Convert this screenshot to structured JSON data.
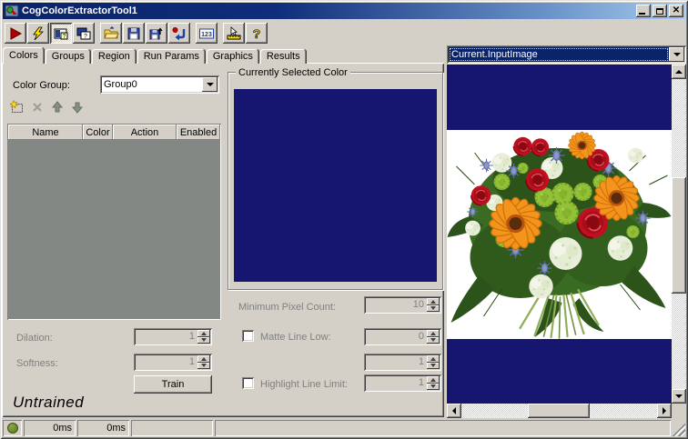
{
  "window": {
    "title": "CogColorExtractorTool1"
  },
  "toolbar": {
    "numeric_label": "123",
    "help_label": "?",
    "tooltip_q": "?"
  },
  "tabs": [
    "Colors",
    "Groups",
    "Region",
    "Run Params",
    "Graphics",
    "Results"
  ],
  "left": {
    "color_group_label": "Color Group:",
    "color_group_value": "Group0",
    "table": {
      "columns": [
        "Name",
        "Color",
        "Action",
        "Enabled"
      ],
      "rows": []
    },
    "dilation_label": "Dilation:",
    "dilation_value": "1",
    "softness_label": "Softness:",
    "softness_value": "1",
    "train_label": "Train",
    "trained_status": "Untrained"
  },
  "center": {
    "group_label": "Currently Selected Color",
    "swatch_color": "#161670",
    "min_pixel_label": "Minimum Pixel Count:",
    "min_pixel_value": "10",
    "matte_low_label": "Matte Line Low:",
    "matte_low_checked": false,
    "matte_low_value": "0",
    "matte_high_value": "1",
    "highlight_label": "Highlight Line Limit:",
    "highlight_checked": false,
    "highlight_value": "1"
  },
  "right": {
    "image_selector_value": "Current.InputImage",
    "canvas_color": "#161670",
    "image_subject": "flower-bouquet",
    "image_background": "#ffffff"
  },
  "statusbar": {
    "run_time": "0ms",
    "tool_time": "0ms"
  },
  "colors": {
    "window_bg": "#d4d0c8",
    "titlebar_start": "#0a246a",
    "titlebar_end": "#a6caf0",
    "selection": "#0a246a",
    "table_body": "#848884"
  }
}
